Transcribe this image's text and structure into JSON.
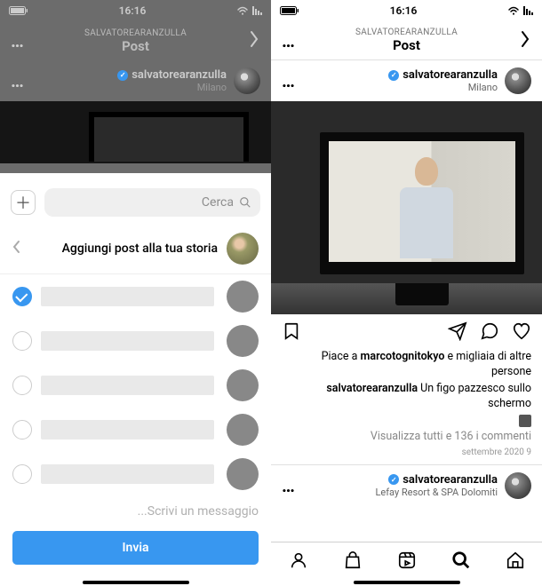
{
  "status_bar": {
    "time": "16:16"
  },
  "header": {
    "username": "SALVATOREARANZULLA",
    "title": "Post"
  },
  "post": {
    "username": "salvatorearanzulla",
    "location": "Milano"
  },
  "likes": {
    "prefix": "Piace a ",
    "example_user": "marcotognitokyo",
    "suffix": " e migliaia di altre persone"
  },
  "caption": {
    "username": "salvatorearanzulla",
    "text": " Un figo pazzesco sullo schermo"
  },
  "comments_link": "Visualizza tutti e 136 i commenti",
  "date": "9 settembre 2020",
  "next_post": {
    "username": "salvatorearanzulla",
    "location": "Lefay Resort & SPA Dolomiti"
  },
  "share_sheet": {
    "search_placeholder": "Cerca",
    "add_to_story_label": "Aggiungi post alla tua storia",
    "message_placeholder": "Scrivi un messaggio...",
    "send_label": "Invia",
    "contacts": [
      {
        "selected": true
      },
      {
        "selected": false
      },
      {
        "selected": false
      },
      {
        "selected": false
      },
      {
        "selected": false
      }
    ]
  },
  "colors": {
    "accent": "#3897f0"
  }
}
